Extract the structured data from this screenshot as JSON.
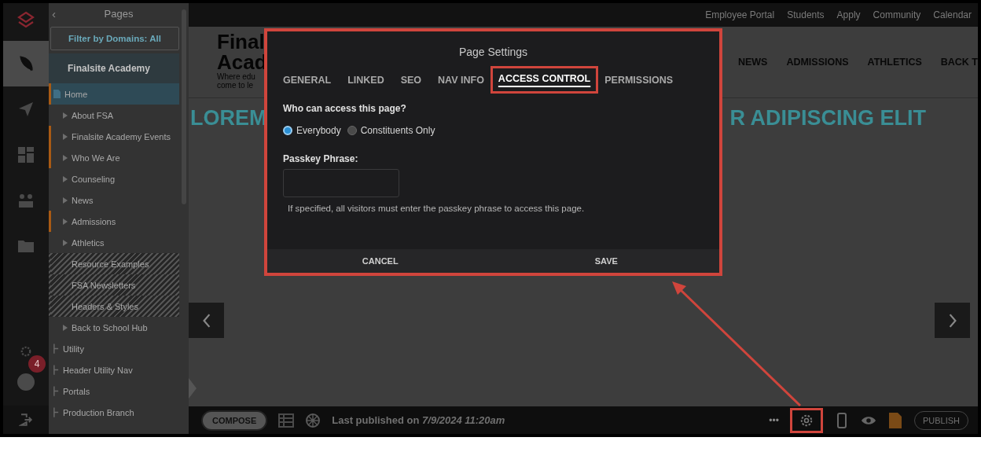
{
  "top_links": [
    "Employee Portal",
    "Students",
    "Apply",
    "Community",
    "Calendar"
  ],
  "rail": {
    "items": [
      {
        "kind": "feather",
        "selected": true
      },
      {
        "kind": "plane",
        "selected": false
      },
      {
        "kind": "dashboard",
        "selected": false
      },
      {
        "kind": "people",
        "selected": false
      },
      {
        "kind": "folder",
        "selected": false
      }
    ],
    "help_badge": "4"
  },
  "sidebar": {
    "back": "‹",
    "title": "Pages",
    "filter": "Filter by Domains: All",
    "root": "Finalsite Academy",
    "items": [
      {
        "label": "Home",
        "selected": true,
        "marked": true,
        "children": [
          {
            "label": "About FSA",
            "selected": false,
            "marked": false,
            "hatched": false,
            "expandable": true
          },
          {
            "label": "Finalsite Academy Events",
            "selected": false,
            "marked": true,
            "hatched": false,
            "expandable": true
          },
          {
            "label": "Who We Are",
            "selected": false,
            "marked": true,
            "hatched": false,
            "expandable": true
          },
          {
            "label": "Counseling",
            "selected": false,
            "marked": false,
            "hatched": false,
            "expandable": true
          },
          {
            "label": "News",
            "selected": false,
            "marked": false,
            "hatched": false,
            "expandable": true
          },
          {
            "label": "Admissions",
            "selected": false,
            "marked": true,
            "hatched": false,
            "expandable": true
          },
          {
            "label": "Athletics",
            "selected": false,
            "marked": false,
            "hatched": false,
            "expandable": true
          },
          {
            "label": "Resource Examples",
            "selected": false,
            "marked": false,
            "hatched": true,
            "expandable": false
          },
          {
            "label": "FSA Newsletters",
            "selected": false,
            "marked": false,
            "hatched": true,
            "expandable": false
          },
          {
            "label": "Headers & Styles",
            "selected": false,
            "marked": false,
            "hatched": true,
            "expandable": false
          },
          {
            "label": "Back to School Hub",
            "selected": false,
            "marked": false,
            "hatched": false,
            "expandable": true
          }
        ]
      },
      {
        "label": "Utility",
        "selected": false,
        "marked": false
      },
      {
        "label": "Header Utility Nav",
        "selected": false,
        "marked": false
      },
      {
        "label": "Portals",
        "selected": false,
        "marked": false
      },
      {
        "label": "Production Branch",
        "selected": false,
        "marked": false
      }
    ]
  },
  "site": {
    "logo_lines": [
      "Final",
      "Acad"
    ],
    "tagline_lines": [
      "Where edu",
      "come to le"
    ],
    "nav": [
      "NEWS",
      "ADMISSIONS",
      "ATHLETICS",
      "BACK T"
    ],
    "heading_left": "LOREM",
    "heading_right": "R ADIPISCING ELIT"
  },
  "bottom_bar": {
    "compose": "COMPOSE",
    "published": "Last published on *7/9/2024 11:20am*",
    "more": "•••",
    "settings_highlighted": true,
    "publish": "PUBLISH"
  },
  "dialog": {
    "title": "Page Settings",
    "tabs": [
      {
        "label": "GENERAL",
        "selected": false
      },
      {
        "label": "LINKED",
        "selected": false
      },
      {
        "label": "SEO",
        "selected": false
      },
      {
        "label": "NAV INFO",
        "selected": false
      },
      {
        "label": "ACCESS CONTROL",
        "selected": true
      },
      {
        "label": "PERMISSIONS",
        "selected": false
      }
    ],
    "question": "Who can access this page?",
    "options": [
      {
        "label": "Everybody",
        "selected": true
      },
      {
        "label": "Constituents Only",
        "selected": false
      }
    ],
    "passkey_label": "Passkey Phrase:",
    "passkey_help": "If specified, all visitors must enter the passkey phrase to access this page.",
    "buttons": [
      "CANCEL",
      "SAVE"
    ]
  }
}
